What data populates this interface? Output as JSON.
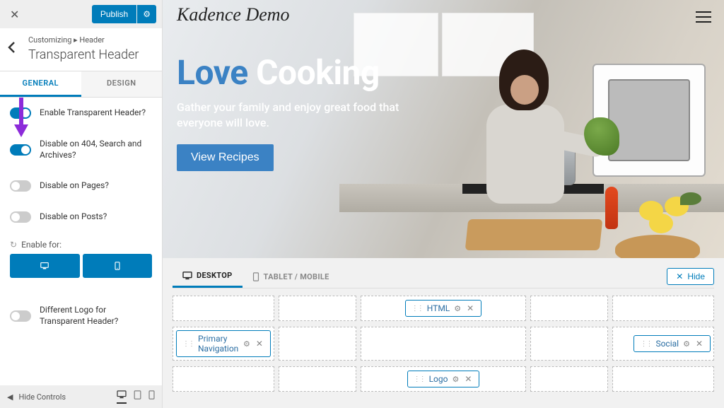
{
  "colors": {
    "primary": "#007cba",
    "accent": "#3b82c4",
    "annotation": "#8c2bd9"
  },
  "topbar": {
    "publish_label": "Publish"
  },
  "panel": {
    "breadcrumb": "Customizing ▸ Header",
    "title": "Transparent Header"
  },
  "tabs": {
    "general": "GENERAL",
    "design": "DESIGN"
  },
  "options": {
    "enable_transparent": {
      "label": "Enable Transparent Header?",
      "on": true
    },
    "disable_404": {
      "label": "Disable on 404, Search and Archives?",
      "on": true
    },
    "disable_pages": {
      "label": "Disable on Pages?",
      "on": false
    },
    "disable_posts": {
      "label": "Disable on Posts?",
      "on": false
    },
    "different_logo": {
      "label": "Different Logo for Transparent Header?",
      "on": false
    }
  },
  "enable_for_label": "Enable for:",
  "footer": {
    "hide_controls": "Hide Controls"
  },
  "site": {
    "title": "Kadence Demo",
    "hero_word1": "Love",
    "hero_word2": "Cooking",
    "subtitle": "Gather your family and enjoy great food that everyone will love.",
    "cta": "View Recipes"
  },
  "builder": {
    "tab_desktop": "DESKTOP",
    "tab_mobile": "TABLET / MOBILE",
    "hide": "Hide",
    "chips": {
      "html": "HTML",
      "primary_nav": "Primary Navigation",
      "social": "Social",
      "logo": "Logo"
    }
  }
}
